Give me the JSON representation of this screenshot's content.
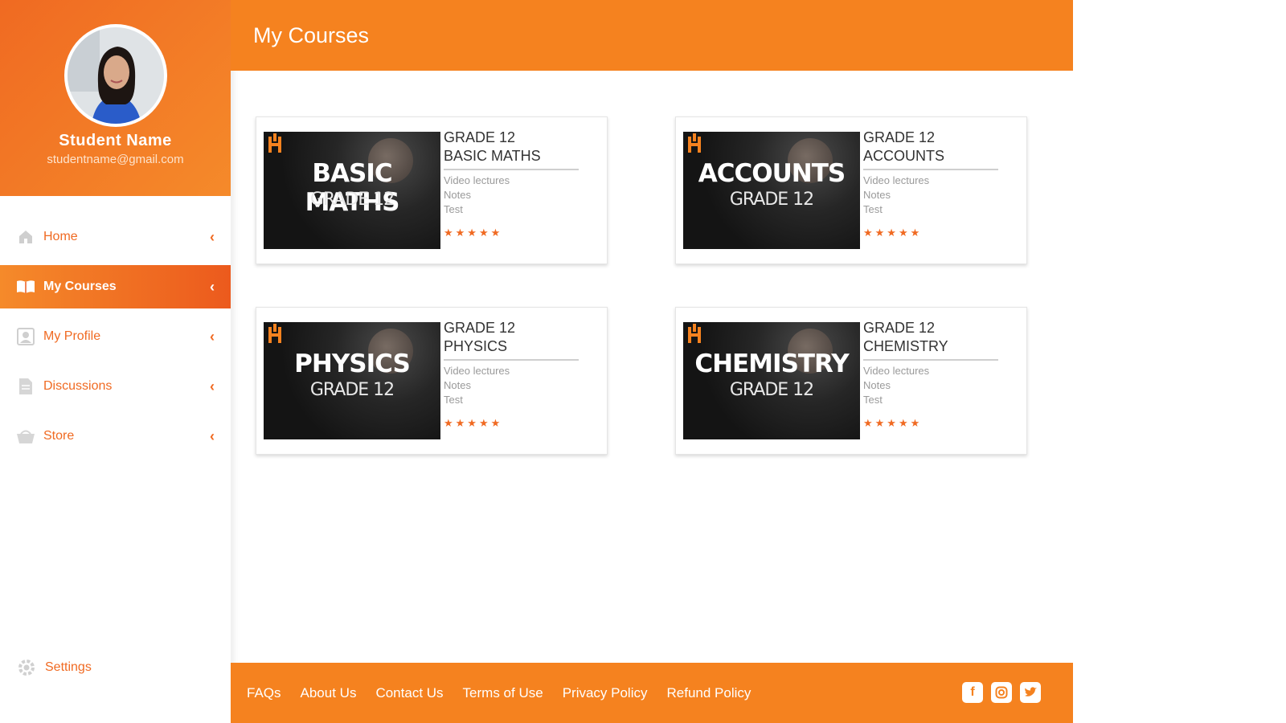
{
  "student": {
    "name": "Student Name",
    "email": "studentname@gmail.com"
  },
  "nav": {
    "items": [
      {
        "label": "Home",
        "icon": "home-icon",
        "active": false
      },
      {
        "label": "My Courses",
        "icon": "book-icon",
        "active": true
      },
      {
        "label": "My Profile",
        "icon": "profile-icon",
        "active": false
      },
      {
        "label": "Discussions",
        "icon": "document-icon",
        "active": false
      },
      {
        "label": "Store",
        "icon": "basket-icon",
        "active": false
      }
    ],
    "settings_label": "Settings"
  },
  "header": {
    "title": "My Courses"
  },
  "courses": [
    {
      "thumb_title": "BASIC MATHS",
      "thumb_grade": "GRADE 12",
      "grade": "GRADE 12",
      "name": "BASIC MATHS",
      "features": [
        "Video lectures",
        "Notes",
        "Test"
      ],
      "rating": 5
    },
    {
      "thumb_title": "ACCOUNTS",
      "thumb_grade": "GRADE 12",
      "grade": "GRADE 12",
      "name": "ACCOUNTS",
      "features": [
        "Video lectures",
        "Notes",
        "Test"
      ],
      "rating": 5
    },
    {
      "thumb_title": "PHYSICS",
      "thumb_grade": "GRADE 12",
      "grade": "GRADE 12",
      "name": "PHYSICS",
      "features": [
        "Video lectures",
        "Notes",
        "Test"
      ],
      "rating": 5
    },
    {
      "thumb_title": "CHEMISTRY",
      "thumb_grade": "GRADE 12",
      "grade": "GRADE 12",
      "name": "CHEMISTRY",
      "features": [
        "Video lectures",
        "Notes",
        "Test"
      ],
      "rating": 5
    }
  ],
  "footer": {
    "links": [
      "FAQs",
      "About Us",
      "Contact Us",
      "Terms of Use",
      "Privacy Policy",
      "Refund Policy"
    ],
    "social": [
      "facebook-icon",
      "instagram-icon",
      "twitter-icon"
    ]
  },
  "colors": {
    "accent": "#f5821f",
    "accent_dark": "#ec5a1d"
  }
}
